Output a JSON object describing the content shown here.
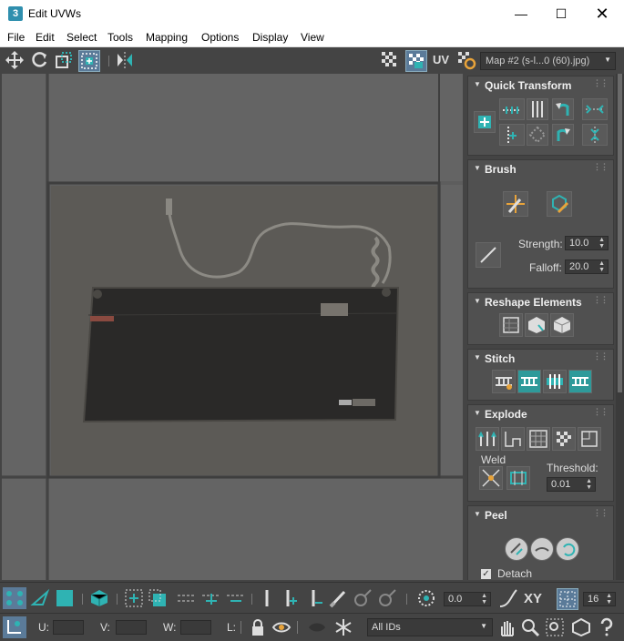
{
  "window": {
    "title": "Edit UVWs",
    "app_icon_label": "3"
  },
  "menu": [
    "File",
    "Edit",
    "Select",
    "Tools",
    "Mapping",
    "Options",
    "Display",
    "View"
  ],
  "toolbar": {
    "uv_label": "UV",
    "map_select": "Map #2 (s-l...0 (60).jpg)"
  },
  "panels": {
    "quick_transform": {
      "title": "Quick Transform"
    },
    "brush": {
      "title": "Brush",
      "strength_label": "Strength:",
      "strength_value": "10.0",
      "falloff_label": "Falloff:",
      "falloff_value": "20.0"
    },
    "reshape": {
      "title": "Reshape Elements"
    },
    "stitch": {
      "title": "Stitch"
    },
    "explode": {
      "title": "Explode",
      "weld_label": "Weld",
      "threshold_label": "Threshold:",
      "threshold_value": "0.01"
    },
    "peel": {
      "title": "Peel",
      "detach_label": "Detach",
      "detach_checked": true
    }
  },
  "bottom": {
    "angle_value": "0.0",
    "xy_label": "XY",
    "grid_value": "16",
    "u_label": "U:",
    "v_label": "V:",
    "w_label": "W:",
    "l_label": "L:",
    "id_select": "All IDs"
  },
  "colors": {
    "accent": "#2fb3b3",
    "panel": "#505050",
    "background": "#444444"
  }
}
